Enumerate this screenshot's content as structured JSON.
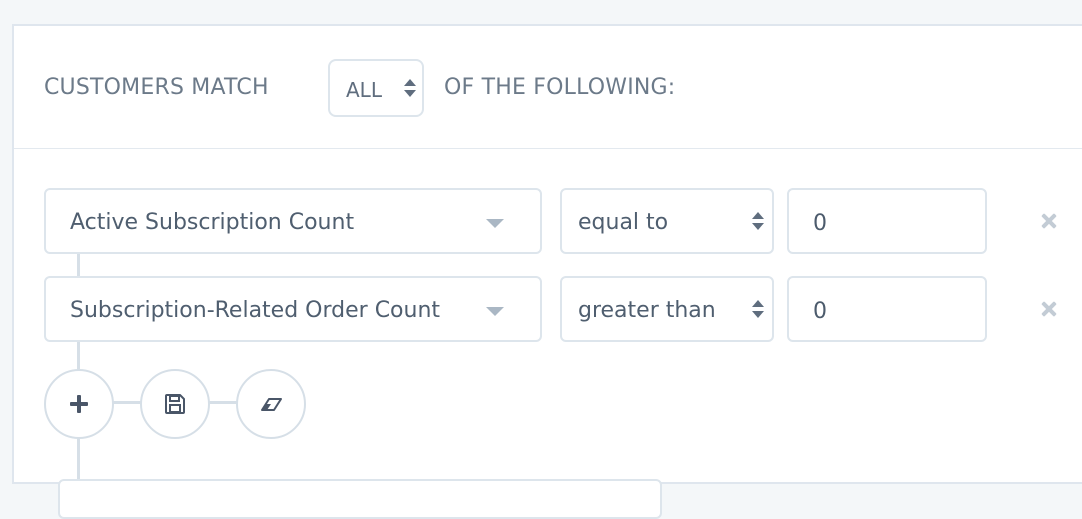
{
  "match": {
    "prefix": "CUSTOMERS MATCH",
    "selected": "ALL",
    "suffix": "OF THE FOLLOWING:"
  },
  "rules": [
    {
      "field": "Active Subscription Count",
      "operator": "equal to",
      "value": "0"
    },
    {
      "field": "Subscription-Related Order Count",
      "operator": "greater than",
      "value": "0"
    }
  ],
  "actions": {
    "add_icon": "plus-icon",
    "save_icon": "floppy-disk-icon",
    "clear_icon": "eraser-icon"
  },
  "colors": {
    "background": "#f4f7f9",
    "border": "#dde5ec",
    "text": "#5f6d7e",
    "connector": "#d6dfe7",
    "remove_icon": "#c3ccd5"
  }
}
